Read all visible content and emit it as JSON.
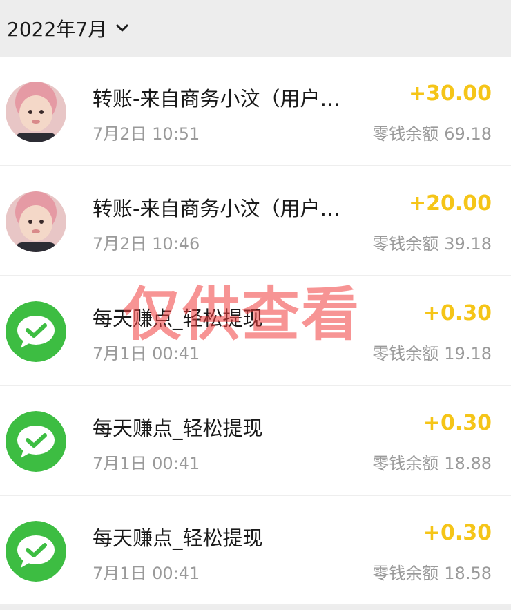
{
  "header": {
    "month": "2022年7月"
  },
  "transactions": [
    {
      "avatar": "child-photo",
      "title": "转账-来自商务小汶（用户…",
      "time": "7月2日 10:51",
      "amount": "+30.00",
      "balance_label": "零钱余额",
      "balance": "69.18"
    },
    {
      "avatar": "child-photo",
      "title": "转账-来自商务小汶（用户…",
      "time": "7月2日 10:46",
      "amount": "+20.00",
      "balance_label": "零钱余额",
      "balance": "39.18"
    },
    {
      "avatar": "wechat-icon",
      "title": "每天赚点_轻松提现",
      "time": "7月1日 00:41",
      "amount": "+0.30",
      "balance_label": "零钱余额",
      "balance": "19.18"
    },
    {
      "avatar": "wechat-icon",
      "title": "每天赚点_轻松提现",
      "time": "7月1日 00:41",
      "amount": "+0.30",
      "balance_label": "零钱余额",
      "balance": "18.88"
    },
    {
      "avatar": "wechat-icon",
      "title": "每天赚点_轻松提现",
      "time": "7月1日 00:41",
      "amount": "+0.30",
      "balance_label": "零钱余额",
      "balance": "18.58"
    }
  ],
  "watermark": "仅供查看",
  "colors": {
    "amount": "#f5c518",
    "wechat_green": "#3dbd42",
    "watermark": "#f03c3c"
  }
}
